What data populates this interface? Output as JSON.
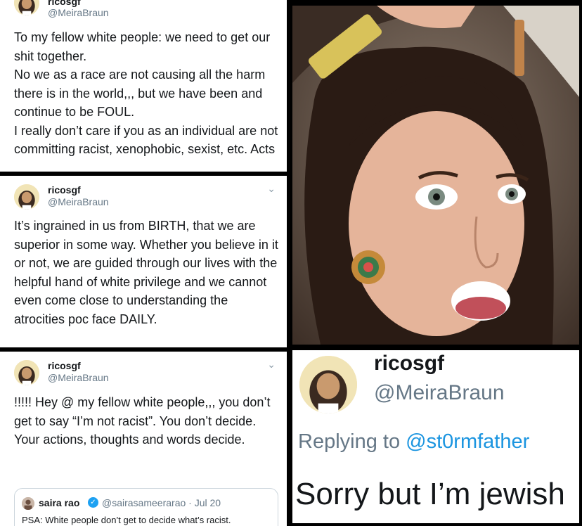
{
  "tweet1": {
    "name": "ricosgf",
    "handle": "@MeiraBraun",
    "text": "To my fellow white people: we need to get our shit together.\nNo we as a race are not causing all the harm there is in the world,,, but we have been and continue to be FOUL.\nI really don’t care if you as an individual are not committing racist, xenophobic, sexist, etc. Acts"
  },
  "tweet2": {
    "name": "ricosgf",
    "handle": "@MeiraBraun",
    "menu_icon": "chevron-down-icon",
    "text": "It’s ingrained in us from BIRTH, that we are superior in some way. Whether you believe in it or not, we are guided through our lives with the helpful hand of white privilege and we cannot even come close to understanding the atrocities poc face DAILY."
  },
  "tweet3": {
    "name": "ricosgf",
    "handle": "@MeiraBraun",
    "menu_icon": "chevron-down-icon",
    "text": "!!!!! Hey @ my fellow white people,,, you don’t get to say “I’m not racist”. You don’t decide. Your actions, thoughts and words decide.",
    "quoted": {
      "name": "saira rao",
      "verified_icon": "verified-badge-icon",
      "handle_date": "@sairasameerarao · Jul 20",
      "text": "PSA: White people don’t get to decide what’s racist."
    }
  },
  "reply": {
    "name": "ricosgf",
    "handle": "@MeiraBraun",
    "replying_prefix": "Replying to",
    "replying_to": "@st0rmfather",
    "text": "Sorry but I’m jewish"
  },
  "colors": {
    "text": "#14171a",
    "secondary": "#657786",
    "link": "#1b95e0",
    "verified": "#1da1f2",
    "separator": "#000000"
  }
}
